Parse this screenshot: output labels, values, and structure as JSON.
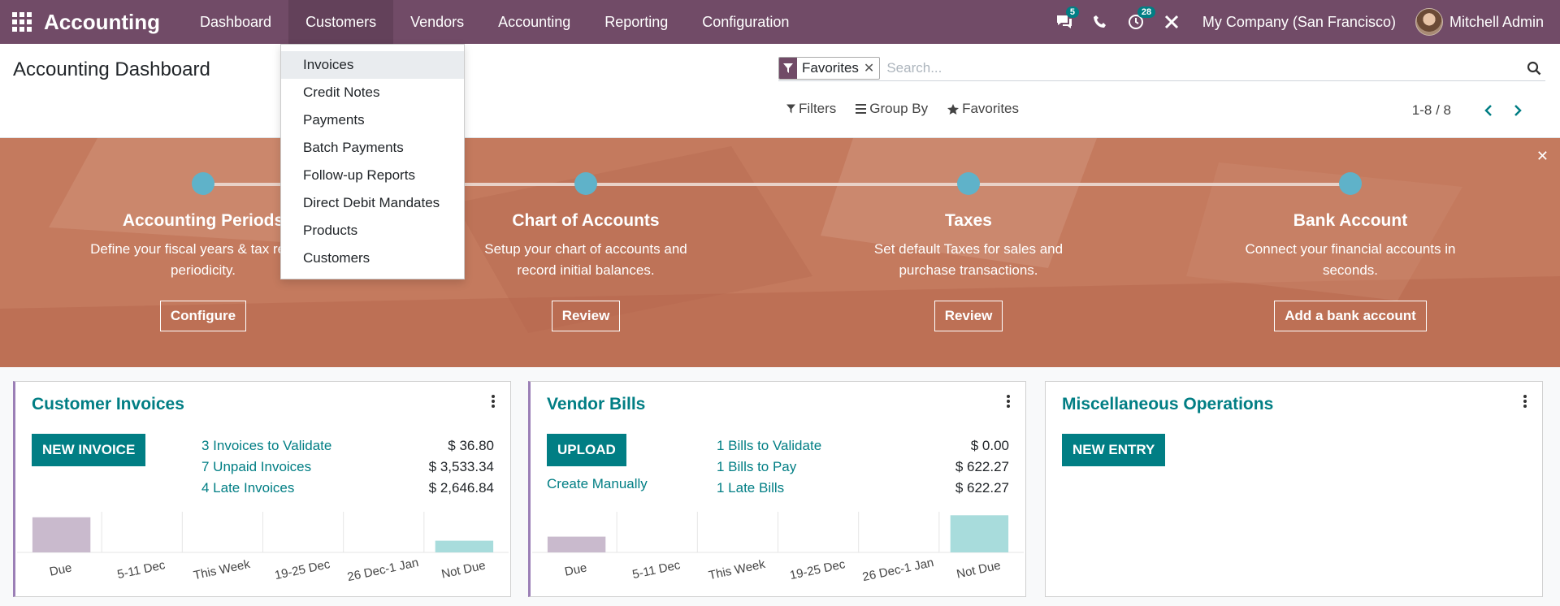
{
  "navbar": {
    "brand": "Accounting",
    "menu": [
      "Dashboard",
      "Customers",
      "Vendors",
      "Accounting",
      "Reporting",
      "Configuration"
    ],
    "messages_count": "5",
    "activities_count": "28",
    "company": "My Company (San Francisco)",
    "user": "Mitchell Admin"
  },
  "dropdown": {
    "items": [
      "Invoices",
      "Credit Notes",
      "Payments",
      "Batch Payments",
      "Follow-up Reports",
      "Direct Debit Mandates",
      "Products",
      "Customers"
    ]
  },
  "control_panel": {
    "title": "Accounting Dashboard",
    "facet": "Favorites",
    "search_placeholder": "Search...",
    "filters": "Filters",
    "group_by": "Group By",
    "favorites": "Favorites",
    "pager": "1-8 / 8"
  },
  "banner": {
    "steps": [
      {
        "title": "Accounting Periods",
        "desc": "Define your fiscal years & tax returns periodicity.",
        "button": "Configure"
      },
      {
        "title": "Chart of Accounts",
        "desc": "Setup your chart of accounts and record initial balances.",
        "button": "Review"
      },
      {
        "title": "Taxes",
        "desc": "Set default Taxes for sales and purchase transactions.",
        "button": "Review"
      },
      {
        "title": "Bank Account",
        "desc": "Connect your financial accounts in seconds.",
        "button": "Add a bank account"
      }
    ]
  },
  "cards": {
    "customer": {
      "title": "Customer Invoices",
      "button": "NEW INVOICE",
      "stats": [
        {
          "label": "3 Invoices to Validate",
          "value": "$ 36.80"
        },
        {
          "label": "7 Unpaid Invoices",
          "value": "$ 3,533.34"
        },
        {
          "label": "4 Late Invoices",
          "value": "$ 2,646.84"
        }
      ]
    },
    "vendor": {
      "title": "Vendor Bills",
      "button": "UPLOAD",
      "link": "Create Manually",
      "stats": [
        {
          "label": "1 Bills to Validate",
          "value": "$ 0.00"
        },
        {
          "label": "1 Bills to Pay",
          "value": "$ 622.27"
        },
        {
          "label": "1 Late Bills",
          "value": "$ 622.27"
        }
      ]
    },
    "misc": {
      "title": "Miscellaneous Operations",
      "button": "NEW ENTRY"
    }
  },
  "chart_data": [
    {
      "type": "bar",
      "categories": [
        "Due",
        "5-11 Dec",
        "This Week",
        "19-25 Dec",
        "26 Dec-1 Jan",
        "Not Due"
      ],
      "values": [
        3.6,
        0,
        0,
        0,
        0,
        1.2
      ],
      "ylim": [
        0,
        4
      ],
      "colors": [
        "#c9bacd",
        "#c9bacd",
        "#c9bacd",
        "#c9bacd",
        "#c9bacd",
        "#a8dcdc"
      ],
      "grid": true
    },
    {
      "type": "bar",
      "categories": [
        "Due",
        "5-11 Dec",
        "This Week",
        "19-25 Dec",
        "26 Dec-1 Jan",
        "Not Due"
      ],
      "values": [
        1.7,
        0,
        0,
        0,
        0,
        4.0
      ],
      "ylim": [
        0,
        4.2
      ],
      "colors": [
        "#c9bacd",
        "#c9bacd",
        "#c9bacd",
        "#c9bacd",
        "#c9bacd",
        "#a8dcdc"
      ],
      "grid": true
    }
  ]
}
